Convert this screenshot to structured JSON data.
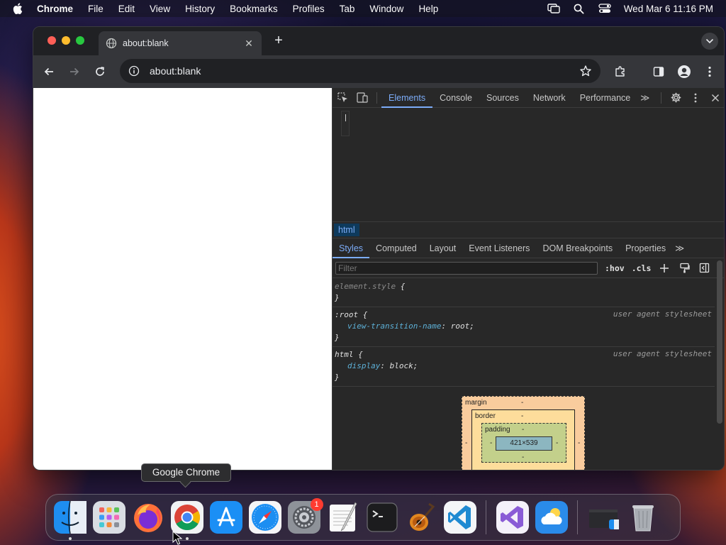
{
  "menubar": {
    "app_name": "Chrome",
    "items": [
      "File",
      "Edit",
      "View",
      "History",
      "Bookmarks",
      "Profiles",
      "Tab",
      "Window",
      "Help"
    ],
    "clock": "Wed Mar 6  11:16 PM"
  },
  "browser": {
    "tab_title": "about:blank",
    "tab_close": "✕",
    "new_tab": "+",
    "url": "about:blank"
  },
  "devtools": {
    "tabs": [
      "Elements",
      "Console",
      "Sources",
      "Network",
      "Performance"
    ],
    "more_tabs": "≫",
    "breadcrumb": "html",
    "sub_tabs": [
      "Styles",
      "Computed",
      "Layout",
      "Event Listeners",
      "DOM Breakpoints",
      "Properties"
    ],
    "more_sub_tabs": "≫",
    "filter_placeholder": "Filter",
    "hov_label": ":hov",
    "cls_label": ".cls",
    "rules": {
      "element_style": {
        "selector": "element.style",
        "open": "{",
        "close": "}"
      },
      "root": {
        "selector": ":root",
        "open": "{",
        "prop": "view-transition-name",
        "value": "root;",
        "close": "}",
        "origin": "user agent stylesheet"
      },
      "html": {
        "selector": "html",
        "open": "{",
        "prop": "display",
        "value": "block;",
        "close": "}",
        "origin": "user agent stylesheet"
      }
    },
    "box_model": {
      "margin_label": "margin",
      "border_label": "border",
      "padding_label": "padding",
      "dash": "-",
      "content_size": "421×539"
    }
  },
  "tooltip": "Google Chrome",
  "dock": {
    "settings_badge": "1"
  }
}
